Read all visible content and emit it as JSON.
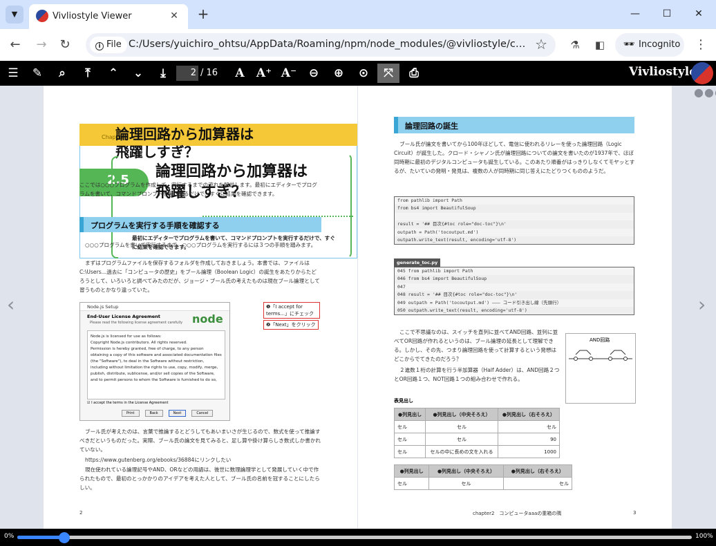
{
  "tab": {
    "title": "Vivliostyle Viewer"
  },
  "window": {
    "minimize": "—",
    "maximize": "☐",
    "close": "✕"
  },
  "address": {
    "scheme_label": "File",
    "url": "C:/Users/yuichiro_ohtsu/AppData/Roaming/npm/node_modules/@vivliostyle/cli/node_mod..."
  },
  "incognito": "Incognito",
  "viewer": {
    "page_current": "2",
    "page_total": "/ 16",
    "brand": "Vivliostyle",
    "progress_left": "0%",
    "progress_right": "100%",
    "progress_value": 0.07
  },
  "left_page": {
    "chapter": "Chapter",
    "title_top": "論理回路から加算器は\n飛躍しすぎ？",
    "section_number": "2.5",
    "title_main": "論理回路から加算器は\n飛躍しすぎ？",
    "lead": "ここでは○○○プログラムを作成して、実行するまでの流れを解説します。最初にエディターでプログラムを書いて、コマンドプロンプトを実行するだけで、すぐに結果を確認できます。",
    "section_heading": "プログラムを実行する手順を確認する",
    "overlay": "最初にエディターでプログラムを書いて、コマンドプロンプトを実行するだけで、すぐに結果を確認できます。",
    "p1": "○○○プログラムを書いて実行するまで、○○○プログラムを実行するには３つの手順を踏みます。",
    "p2": "まずはプログラムファイルを保存するフォルダを作成しておきましょう。本書では、ファイルはC:\\Users…過去に「コンピュータの歴史」をブール論理（Boolean Logic）の誕生をあたりからたどろうとして、いろいろと調べてみたのだが、ジョージ・ブール氏の考えたものは現在ブール論理として習うものとかなり違っていた。",
    "screenshot": {
      "title": "Node.js Setup",
      "heading": "End-User License Agreement",
      "sub": "Please read the following license agreement carefully",
      "body": "Node.js is licensed for use as follows:\nCopyright Node.js contributors. All rights reserved.\nPermission is hereby granted, free of charge, to any person obtaining a copy of this software and associated documentation files (the \"Software\"), to deal in the Software without restriction, including without limitation the rights to use, copy, modify, merge, publish, distribute, sublicense, and/or sell copies of the Software, and to permit persons to whom the Software is furnished to do so,",
      "checkbox": "I accept the terms in the License Agreement",
      "btn_print": "Print",
      "btn_back": "Back",
      "btn_next": "Next",
      "btn_cancel": "Cancel",
      "logo": "node"
    },
    "callout1": "❶「I accept for terms...」にチェック",
    "callout2": "❷「Next」をクリック",
    "p3": "ブール氏が考えたのは、言葉で推論するとどうしてもあいまいさが生じるので、数式を使って推論すべきだというものだった。実際、ブール氏の論文を見てみると、足し算や掛け算らしき数式しか書かれていない。",
    "link": "https://www.gutenberg.org/ebooks/36884にリンクしたい",
    "p4": "現在使われている論理記号やAND、ORなどの用語は、後世に数理論理学として発展していく中で作られたもので、最初のとっかかりのアイデアを考えた人として、ブール氏の名前を冠することにしたらしい。",
    "page_number": "2"
  },
  "right_page": {
    "section_heading": "論理回路の誕生",
    "p1": "ブール氏が論文を書いてから100年ほどして、電信に使われるリレーを使った論理回路（Logic Circuit）が誕生した。クロード・シャノン氏が論理回路についての論文を書いたのが1937年で、ほぼ同時期に最初のデジタルコンピュータも誕生している。このあたり順番がはっきりしなくてモヤッとするが、たいていの発明・発見は、複数の人が同時期に同じ答えにたどりつくもののようだ。",
    "code1": [
      "from pathlib import Path",
      "from bs4 import BeautifulSoup",
      "",
      "result = '## 目次{#toc role=\"doc-toc\"}\\n'",
      "outpath = Path('tocoutput.md')",
      "outpath.write_text(result, encoding='utf-8')"
    ],
    "code_label": "generate_toc.py",
    "code2": [
      "045 from pathlib import Path",
      "046 from bs4 import BeautifulSoup",
      "047",
      "048 result = '## 目次{#toc role=\"doc-toc\"}\\n'",
      "049 outpath = Path('tocoutput.md')      ――― コード引き出し線（先頭行）",
      "050 outpath.write_text(result, encoding='utf-8')"
    ],
    "p2": "ここで不思議なのは、スイッチを直列に並べてAND回路、並列に並べてOR回路が作れるというのは、ブール論理の延長として理解できる。しかし、その先、つまり論理回路を使って計算するという発想はどこからでてきたのだろう？",
    "p3": "２進数１桁の計算を行う半加算器（Half Adder）は、AND回路２つとOR回路１つ、NOT回路１つの組み合わせで作れる。",
    "figure_title": "AND回路",
    "table_caption": "表見出し",
    "table1": {
      "headers": [
        "●列見出し",
        "●列見出し（中央そろえ）",
        "●列見出し（右そろえ）"
      ],
      "rows": [
        [
          "セル",
          "セル",
          "セル"
        ],
        [
          "セル",
          "セル",
          "90"
        ],
        [
          "セル",
          "セルの中に長めの文を入れる",
          "1000"
        ]
      ]
    },
    "table2": {
      "headers": [
        "●列見出し",
        "●列見出し（中央そろえ）",
        "●列見出し（右そろえ）"
      ],
      "rows": [
        [
          "セル",
          "セル",
          "セル"
        ]
      ]
    },
    "footer": "chapter2　コンピュータaaaの重箱の隅",
    "page_number": "3"
  }
}
